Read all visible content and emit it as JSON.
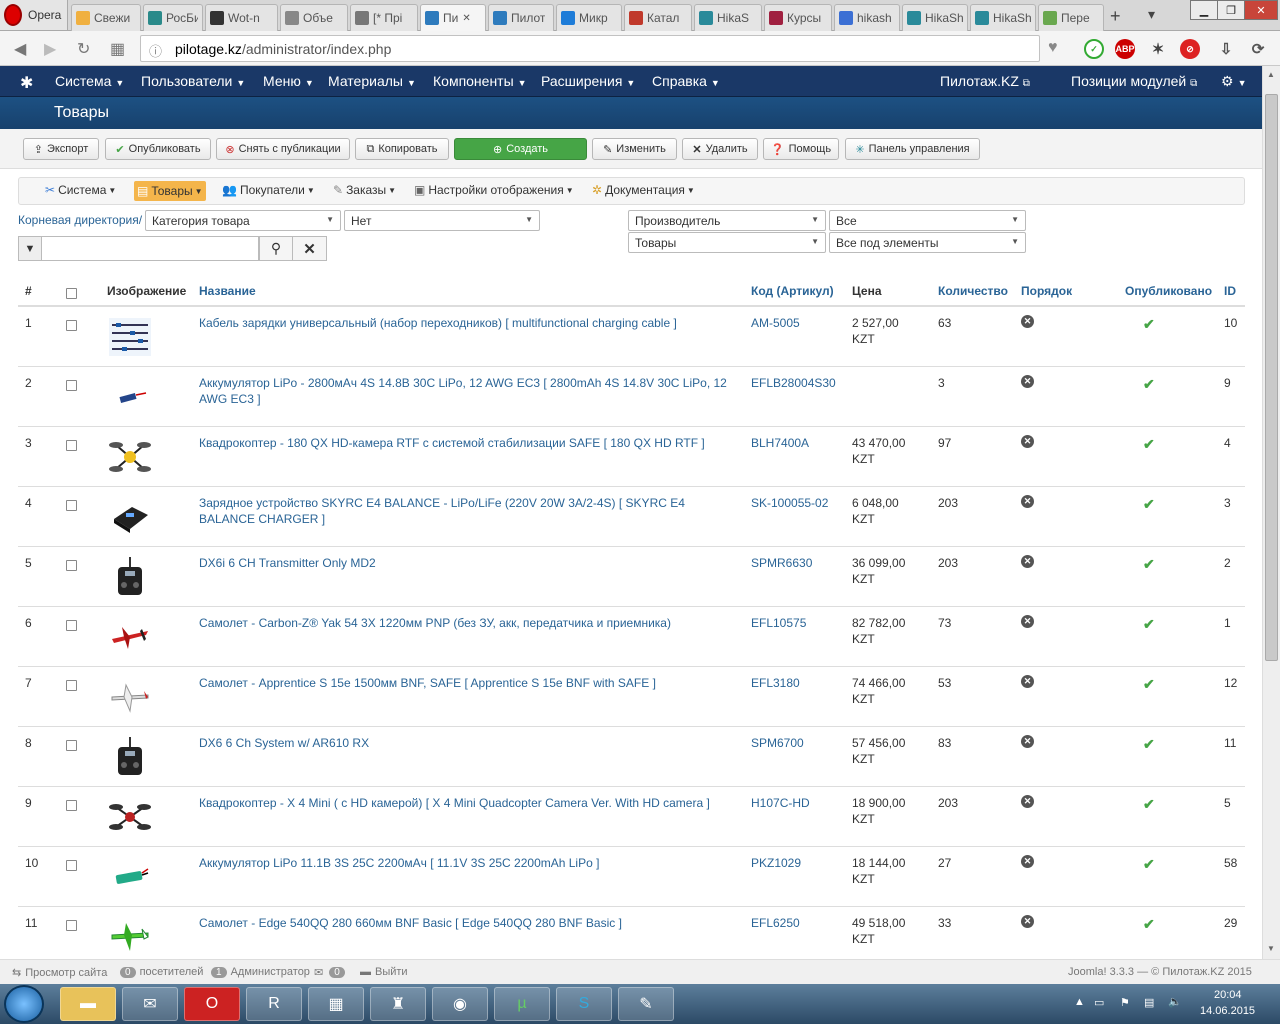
{
  "browser": {
    "opera_label": "Opera",
    "tabs": [
      {
        "label": "Свежи",
        "color": "#f0b040"
      },
      {
        "label": "РосБи",
        "color": "#2a8a8a"
      },
      {
        "label": "Wot-n",
        "color": "#333333"
      },
      {
        "label": "Объе",
        "color": "#888888"
      },
      {
        "label": "[* Прі",
        "color": "#777777"
      },
      {
        "label": "Пи",
        "color": "#2e7bbd"
      },
      {
        "label": "Пилот",
        "color": "#2e7bbd"
      },
      {
        "label": "Микр",
        "color": "#1e7cd8"
      },
      {
        "label": "Катал",
        "color": "#c0392b"
      },
      {
        "label": "HikaS",
        "color": "#2a8a9a"
      },
      {
        "label": "Курсы",
        "color": "#a02040"
      },
      {
        "label": "hikash",
        "color": "#3b6fd4"
      },
      {
        "label": "HikaSh",
        "color": "#2a8a9a"
      },
      {
        "label": "HikaSh",
        "color": "#2a8a9a"
      },
      {
        "label": "Пере",
        "color": "#6aa84f"
      }
    ],
    "url_host": "pilotage.kz",
    "url_path": "/administrator/index.php"
  },
  "menu": {
    "items": [
      "Система",
      "Пользователи",
      "Меню",
      "Материалы",
      "Компоненты",
      "Расширения",
      "Справка"
    ],
    "site_link": "Пилотаж.KZ",
    "modules_link": "Позиции модулей"
  },
  "page": {
    "title": "Товары"
  },
  "toolbar": {
    "export": "Экспорт",
    "publish": "Опубликовать",
    "unpublish": "Снять с публикации",
    "copy": "Копировать",
    "create": "Создать",
    "edit": "Изменить",
    "delete": "Удалить",
    "help": "Помощь",
    "dashboard": "Панель управления"
  },
  "submenu": {
    "items": [
      "Система",
      "Товары",
      "Покупатели",
      "Заказы",
      "Настройки отображения",
      "Документация"
    ]
  },
  "filters": {
    "root": "Корневая директория/",
    "category": "Категория товара",
    "none": "Нет",
    "manufacturer": "Производитель",
    "all": "Все",
    "products": "Товары",
    "all_elements": "Все под элементы",
    "search_value": ""
  },
  "table": {
    "headers": {
      "num": "#",
      "image": "Изображение",
      "name": "Название",
      "code": "Код (Артикул)",
      "price": "Цена",
      "qty": "Количество",
      "order": "Порядок",
      "published": "Опубликовано",
      "id": "ID"
    },
    "rows": [
      {
        "n": "1",
        "name": "Кабель зарядки универсальный (набор переходников) [ multifunctional charging cable ]",
        "code": "AM-5005",
        "price": "2 527,00",
        "cur": "KZT",
        "qty": "63",
        "id": "10",
        "img": "cable"
      },
      {
        "n": "2",
        "name": "Аккумулятор LiPo - 2800мАч 4S 14.8В 30C LiPo, 12 AWG EC3 [ 2800mAh 4S 14.8V 30C LiPo, 12 AWG EC3 ]",
        "code": "EFLB28004S30",
        "price": "",
        "cur": "",
        "qty": "3",
        "id": "9",
        "img": "battery-small"
      },
      {
        "n": "3",
        "name": "Квадрокоптер - 180 QX HD-камера RTF с системой стабилизации SAFE [ 180 QX HD RTF ]",
        "code": "BLH7400A",
        "price": "43 470,00",
        "cur": "KZT",
        "qty": "97",
        "id": "4",
        "img": "quad-yellow"
      },
      {
        "n": "4",
        "name": "Зарядное устройство SKYRC E4 BALANCE - LiPo/LiFe (220V 20W 3A/2-4S) [ SKYRC E4 BALANCE CHARGER ]",
        "code": "SK-100055-02",
        "price": "6 048,00",
        "cur": "KZT",
        "qty": "203",
        "id": "3",
        "img": "charger"
      },
      {
        "n": "5",
        "name": "DX6i 6 CH Transmitter Only MD2",
        "code": "SPMR6630",
        "price": "36 099,00",
        "cur": "KZT",
        "qty": "203",
        "id": "2",
        "img": "transmitter"
      },
      {
        "n": "6",
        "name": "Самолет - Carbon-Z® Yak 54 3X 1220мм PNP (без ЗУ, акк, передатчика и приемника)",
        "code": "EFL10575",
        "price": "82 782,00",
        "cur": "KZT",
        "qty": "73",
        "id": "1",
        "img": "plane-red"
      },
      {
        "n": "7",
        "name": "Самолет - Apprentice S 15e 1500мм BNF, SAFE [ Apprentice S 15e BNF with SAFE ]",
        "code": "EFL3180",
        "price": "74 466,00",
        "cur": "KZT",
        "qty": "53",
        "id": "12",
        "img": "plane-white"
      },
      {
        "n": "8",
        "name": "DX6 6 Ch System w/ AR610 RX",
        "code": "SPM6700",
        "price": "57 456,00",
        "cur": "KZT",
        "qty": "83",
        "id": "11",
        "img": "transmitter"
      },
      {
        "n": "9",
        "name": "Квадрокоптер - X 4 Mini ( с HD камерой) [ X 4 Mini Quadcopter Camera Ver. With HD camera ]",
        "code": "H107C-HD",
        "price": "18 900,00",
        "cur": "KZT",
        "qty": "203",
        "id": "5",
        "img": "quad-dark"
      },
      {
        "n": "10",
        "name": "Аккумулятор LiPo 11.1В 3S 25C 2200мАч [ 11.1V 3S 25C 2200mAh LiPo ]",
        "code": "PKZ1029",
        "price": "18 144,00",
        "cur": "KZT",
        "qty": "27",
        "id": "58",
        "img": "battery-green"
      },
      {
        "n": "11",
        "name": "Самолет - Edge 540QQ 280 660мм BNF Basic [ Edge 540QQ 280 BNF Basic ]",
        "code": "EFL6250",
        "price": "49 518,00",
        "cur": "KZT",
        "qty": "33",
        "id": "29",
        "img": "plane-green"
      }
    ]
  },
  "footer": {
    "view_site": "Просмотр сайта",
    "visitors_count": "0",
    "visitors": "посетителей",
    "admins_count": "1",
    "admins": "Администратор",
    "messages_count": "0",
    "logout": "Выйти",
    "version": "Joomla! 3.3.3",
    "copyright": "© Пилотаж.KZ 2015"
  },
  "taskbar": {
    "time": "20:04",
    "date": "14.06.2015"
  },
  "colors": {
    "menu_bg": "#1a3867",
    "title_bg": "#1d5183",
    "link": "#2a6496",
    "green": "#46a546",
    "active_sub": "#f4b54b"
  }
}
